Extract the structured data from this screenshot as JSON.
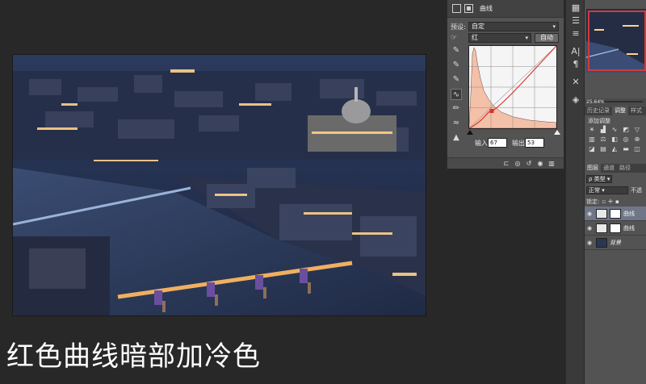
{
  "caption": "红色曲线暗部加冷色",
  "curves_panel": {
    "title": "曲线",
    "preset_label": "预设:",
    "preset_value": "自定",
    "channel_value": "红",
    "auto_button": "自动",
    "input_label": "输入:",
    "input_value": "67",
    "output_label": "输出:",
    "output_value": "53",
    "curve_color": "#d9302b"
  },
  "right_panel": {
    "zoom": "25.64%",
    "tabs_top": [
      "历史记录",
      "调整",
      "样式"
    ],
    "adjust_title": "添加调整",
    "tabs_layers": [
      "图层",
      "通道",
      "路径"
    ],
    "filter_kind": "类型",
    "blend_mode": "正常",
    "opacity_abbrev": "不透",
    "lock_label": "锁定:",
    "layers": [
      {
        "name": "曲线",
        "selected": true
      },
      {
        "name": "曲线",
        "selected": false
      },
      {
        "name": "背景",
        "selected": false
      }
    ]
  },
  "toolstrip": {
    "icons": [
      "properties-icon",
      "adjust-icon",
      "align-icon",
      "text-style-icon",
      "paragraph-icon",
      "tools-icon",
      "3d-icon"
    ]
  }
}
